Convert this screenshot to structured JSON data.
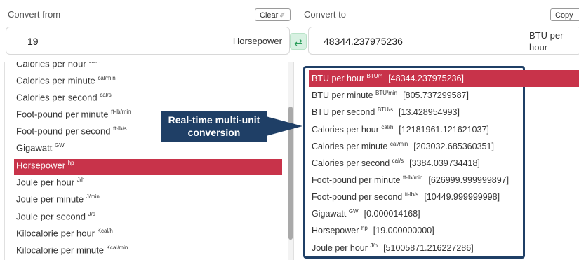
{
  "from": {
    "label": "Convert from",
    "clear_label": "Clear",
    "value": "19",
    "unit": "Horsepower"
  },
  "to": {
    "label": "Convert to",
    "copy_label": "Copy",
    "value": "48344.237975236",
    "unit": "BTU per hour"
  },
  "swap_icon": "swap-arrows-icon",
  "left_list": [
    {
      "name": "Calories per hour",
      "sym": "cal/h"
    },
    {
      "name": "Calories per minute",
      "sym": "cal/min"
    },
    {
      "name": "Calories per second",
      "sym": "cal/s"
    },
    {
      "name": "Foot-pound per minute",
      "sym": "ft-lb/min"
    },
    {
      "name": "Foot-pound per second",
      "sym": "ft-lb/s"
    },
    {
      "name": "Gigawatt",
      "sym": "GW"
    },
    {
      "name": "Horsepower",
      "sym": "hp",
      "selected": true
    },
    {
      "name": "Joule per hour",
      "sym": "J/h"
    },
    {
      "name": "Joule per minute",
      "sym": "J/min"
    },
    {
      "name": "Joule per second",
      "sym": "J/s"
    },
    {
      "name": "Kilocalorie per hour",
      "sym": "Kcal/h"
    },
    {
      "name": "Kilocalorie per minute",
      "sym": "Kcal/min"
    }
  ],
  "results": [
    {
      "name": "BTU per hour",
      "sym": "BTU/h",
      "value": "[48344.237975236]",
      "selected": true
    },
    {
      "name": "BTU per minute",
      "sym": "BTU/min",
      "value": "[805.737299587]"
    },
    {
      "name": "BTU per second",
      "sym": "BTU/s",
      "value": "[13.428954993]"
    },
    {
      "name": "Calories per hour",
      "sym": "cal/h",
      "value": "[12181961.121621037]"
    },
    {
      "name": "Calories per minute",
      "sym": "cal/min",
      "value": "[203032.685360351]"
    },
    {
      "name": "Calories per second",
      "sym": "cal/s",
      "value": "[3384.039734418]"
    },
    {
      "name": "Foot-pound per minute",
      "sym": "ft-lb/min",
      "value": "[626999.999999897]"
    },
    {
      "name": "Foot-pound per second",
      "sym": "ft-lb/s",
      "value": "[10449.999999998]"
    },
    {
      "name": "Gigawatt",
      "sym": "GW",
      "value": "[0.000014168]"
    },
    {
      "name": "Horsepower",
      "sym": "hp",
      "value": "[19.000000000]"
    },
    {
      "name": "Joule per hour",
      "sym": "J/h",
      "value": "[51005871.216227286]"
    }
  ],
  "callout": "Real-time multi-unit conversion",
  "colors": {
    "selected": "#c8334a",
    "callout": "#1f3f66",
    "swap": "#2a9d5a"
  }
}
